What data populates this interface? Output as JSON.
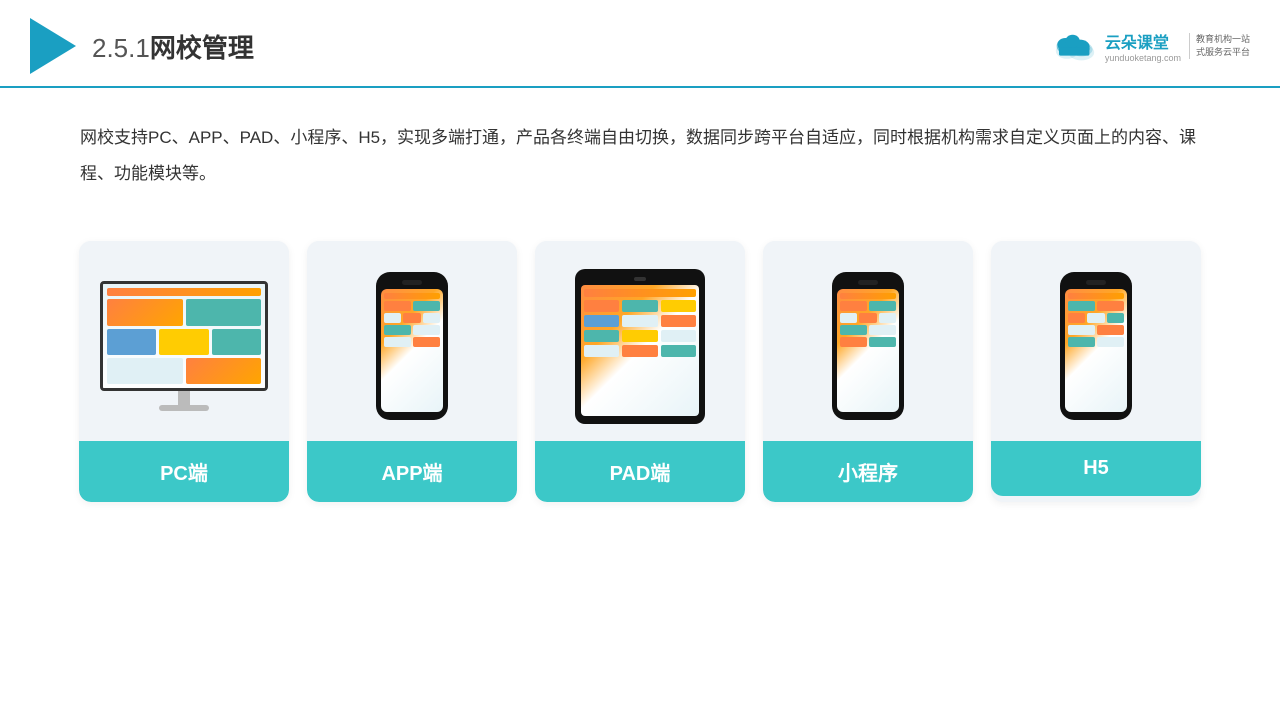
{
  "header": {
    "title_prefix": "2.5.1",
    "title_main": "网校管理",
    "border_color": "#1a9fc2"
  },
  "brand": {
    "name": "云朵课堂",
    "url": "yunduoketang.com",
    "slogan_line1": "教育机构一站",
    "slogan_line2": "式服务云平台"
  },
  "description": {
    "text": "网校支持PC、APP、PAD、小程序、H5，实现多端打通，产品各终端自由切换，数据同步跨平台自适应，同时根据机构需求自定义页面上的内容、课程、功能模块等。"
  },
  "cards": [
    {
      "id": "pc",
      "label": "PC端",
      "type": "monitor"
    },
    {
      "id": "app",
      "label": "APP端",
      "type": "phone"
    },
    {
      "id": "pad",
      "label": "PAD端",
      "type": "tablet"
    },
    {
      "id": "miniapp",
      "label": "小程序",
      "type": "phone"
    },
    {
      "id": "h5",
      "label": "H5",
      "type": "phone"
    }
  ],
  "colors": {
    "teal": "#3cc8c8",
    "accent": "#1a9fc2",
    "card_bg": "#f0f4f8"
  }
}
